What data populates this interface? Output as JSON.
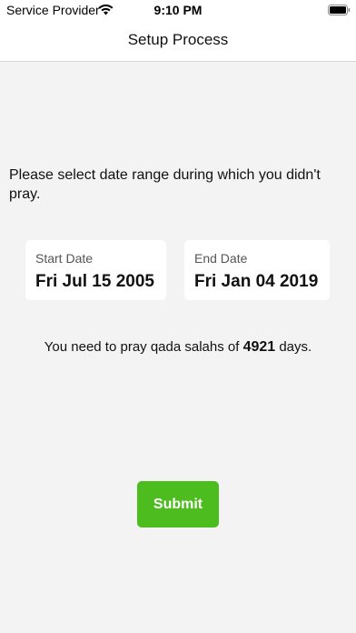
{
  "status_bar": {
    "carrier": "Service Provider",
    "time": "9:10 PM",
    "wifi_icon": "wifi-icon",
    "battery_icon": "battery-icon"
  },
  "nav": {
    "title": "Setup Process"
  },
  "instruction": "Please select date range during which you didn't pray.",
  "start_date": {
    "label": "Start Date",
    "value": "Fri Jul 15 2005"
  },
  "end_date": {
    "label": "End Date",
    "value": "Fri Jan 04 2019"
  },
  "result": {
    "prefix": "You need to pray qada salahs of ",
    "days": "4921",
    "suffix": " days."
  },
  "submit_label": "Submit",
  "colors": {
    "accent": "#4cbc1f",
    "background": "#f3f3f3",
    "card": "#ffffff"
  }
}
